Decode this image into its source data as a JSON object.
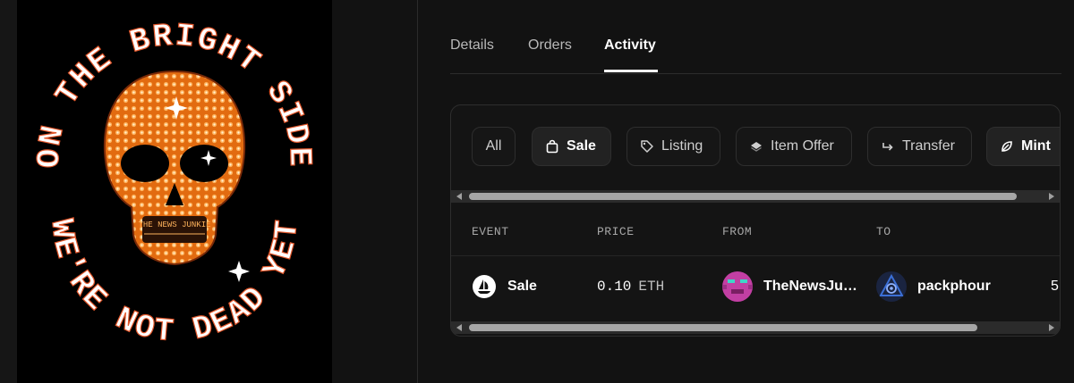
{
  "artwork": {
    "top_text": "ON THE BRIGHT SIDE",
    "bottom_text": "WE'RE NOT DEAD YET",
    "teeth_text": "THE NEWS JUNKIE"
  },
  "tabs": [
    {
      "label": "Details"
    },
    {
      "label": "Orders"
    },
    {
      "label": "Activity"
    }
  ],
  "filters": [
    {
      "label": "All"
    },
    {
      "label": "Sale"
    },
    {
      "label": "Listing"
    },
    {
      "label": "Item Offer"
    },
    {
      "label": "Transfer"
    },
    {
      "label": "Mint"
    }
  ],
  "table": {
    "columns": [
      "EVENT",
      "PRICE",
      "FROM",
      "TO"
    ],
    "rows": [
      {
        "event": "Sale",
        "price": "0.10",
        "unit": "ETH",
        "from": "TheNewsJu…",
        "to": "packphour",
        "extra": "5"
      }
    ]
  },
  "colors": {
    "accent_orange": "#f08a24",
    "background": "#121212",
    "avatar_magenta": "#c23fa3",
    "avatar_blue": "#3b6fd6"
  }
}
